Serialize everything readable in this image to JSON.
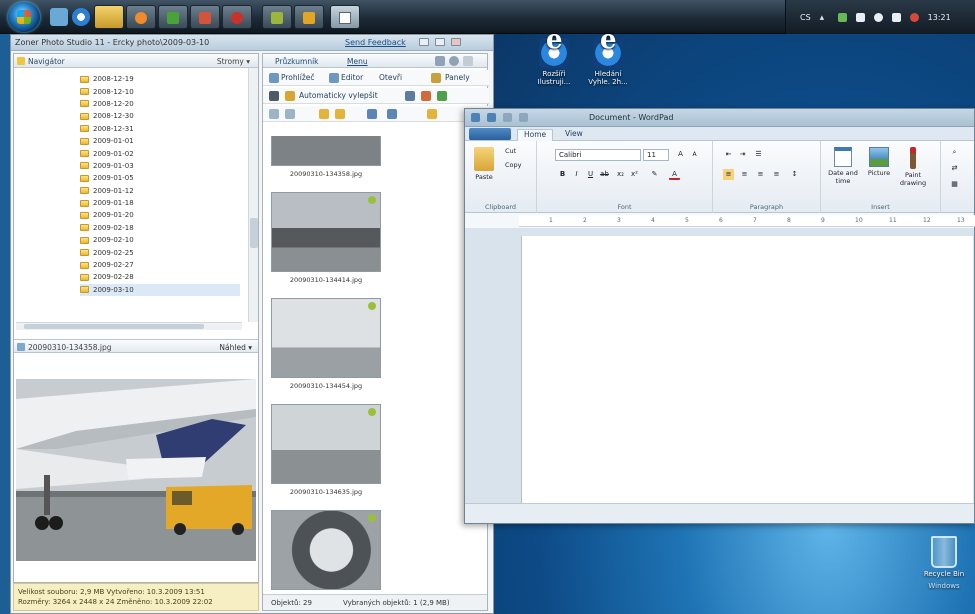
{
  "taskbar": {
    "tray": {
      "language": "CS",
      "clock": "13:21"
    }
  },
  "desktop": {
    "icons": [
      {
        "label_line1": "Rozšíři",
        "label_line2": "Ilustruji..."
      },
      {
        "label_line1": "Hledání",
        "label_line2": "Vyhle. 2h..."
      }
    ],
    "recycle_bin": {
      "label": "Recycle Bin",
      "sub": "Windows"
    }
  },
  "studio": {
    "title": "Zoner Photo Studio 11 - Ercky photo\\2009-03-10",
    "send_feedback": "Send Feedback",
    "navigator": {
      "title": "Navigátor",
      "view": "Stromy ▾"
    },
    "folders": [
      "2008-12-19",
      "2008-12-10",
      "2008-12-20",
      "2008-12-30",
      "2008-12-31",
      "2009-01-01",
      "2009-01-02",
      "2009-01-03",
      "2009-01-05",
      "2009-01-12",
      "2009-01-18",
      "2009-01-20",
      "2009-02-18",
      "2009-02-10",
      "2009-02-25",
      "2009-02-27",
      "2009-02-28",
      "2009-03-10"
    ],
    "preview": {
      "file": "20090310-134358.jpg",
      "mode": "Náhled ▾"
    },
    "status": {
      "line1": "Velikost souboru: 2,9 MB    Vytvořeno: 10.3.2009 13:51",
      "line2": "Rozměry: 3264 x 2448 x 24    Změněno: 10.3.2009 22:02"
    },
    "browser": {
      "tab_browser": "Průzkumník",
      "tab_menu": "Menu",
      "toolbar1": {
        "preview": "Prohlížeč",
        "editor": "Editor",
        "open": "Otevři",
        "panely": "Panely"
      },
      "toolbar2": {
        "auto": "Automaticky vylepšit"
      },
      "thumbnails": [
        {
          "name": "20090310-134358.jpg"
        },
        {
          "name": "20090310-134414.jpg"
        },
        {
          "name": "20090310-134454.jpg"
        },
        {
          "name": "20090310-134635.jpg"
        },
        {
          "name": ""
        }
      ],
      "status_left": "Objektů: 29",
      "status_right": "Vybraných objektů: 1 (2,9 MB)"
    }
  },
  "wordpad": {
    "title": "Document - WordPad",
    "tabs": {
      "home": "Home",
      "view": "View"
    },
    "ribbon": {
      "clipboard": {
        "name": "Clipboard",
        "paste": "Paste",
        "cut": "Cut",
        "copy": "Copy"
      },
      "font": {
        "name": "Font",
        "family": "Calibri",
        "size": "11"
      },
      "paragraph": {
        "name": "Paragraph"
      },
      "insert": {
        "name": "Insert",
        "datetime": "Date and time",
        "picture": "Picture",
        "paint": "Paint drawing"
      }
    },
    "ruler": [
      "1",
      "2",
      "3",
      "4",
      "5",
      "6",
      "7",
      "8",
      "9",
      "10",
      "11",
      "12",
      "13"
    ]
  }
}
